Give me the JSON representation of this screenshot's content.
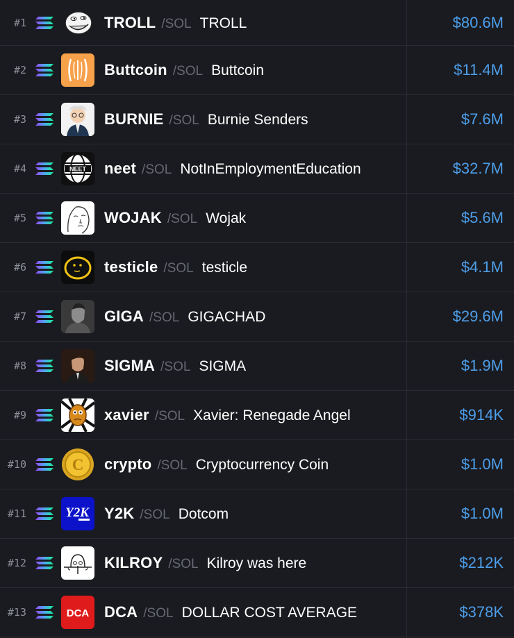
{
  "colors": {
    "background": "#1a1b20",
    "row_border": "#2b2c33",
    "rank": "#8e9099",
    "pair": "#666873",
    "market_cap": "#4d9ee9",
    "solana_gradient": [
      "#9945ff",
      "#4fa8f0",
      "#14f195"
    ]
  },
  "chain_icon": "solana-icon",
  "tokens": [
    {
      "rank": "#1",
      "ticker": "TROLL",
      "pair": "/SOL",
      "name": "TROLL",
      "market_cap": "$80.6M",
      "icon": "troll-face-icon"
    },
    {
      "rank": "#2",
      "ticker": "Buttcoin",
      "pair": "/SOL",
      "name": "Buttcoin",
      "market_cap": "$11.4M",
      "icon": "buttcoin-logo-icon"
    },
    {
      "rank": "#3",
      "ticker": "BURNIE",
      "pair": "/SOL",
      "name": "Burnie Senders",
      "market_cap": "$7.6M",
      "icon": "burnie-portrait-icon"
    },
    {
      "rank": "#4",
      "ticker": "neet",
      "pair": "/SOL",
      "name": "NotInEmploymentEducation",
      "market_cap": "$32.7M",
      "icon": "neet-globe-icon"
    },
    {
      "rank": "#5",
      "ticker": "WOJAK",
      "pair": "/SOL",
      "name": "Wojak",
      "market_cap": "$5.6M",
      "icon": "wojak-face-icon"
    },
    {
      "rank": "#6",
      "ticker": "testicle",
      "pair": "/SOL",
      "name": "testicle",
      "market_cap": "$4.1M",
      "icon": "testicle-face-icon"
    },
    {
      "rank": "#7",
      "ticker": "GIGA",
      "pair": "/SOL",
      "name": "GIGACHAD",
      "market_cap": "$29.6M",
      "icon": "gigachad-portrait-icon"
    },
    {
      "rank": "#8",
      "ticker": "SIGMA",
      "pair": "/SOL",
      "name": "SIGMA",
      "market_cap": "$1.9M",
      "icon": "sigma-portrait-icon"
    },
    {
      "rank": "#9",
      "ticker": "xavier",
      "pair": "/SOL",
      "name": "Xavier: Renegade Angel",
      "market_cap": "$914K",
      "icon": "xavier-face-icon"
    },
    {
      "rank": "#10",
      "ticker": "crypto",
      "pair": "/SOL",
      "name": "Cryptocurrency Coin",
      "market_cap": "$1.0M",
      "icon": "gold-coin-icon"
    },
    {
      "rank": "#11",
      "ticker": "Y2K",
      "pair": "/SOL",
      "name": "Dotcom",
      "market_cap": "$1.0M",
      "icon": "y2k-logo-icon"
    },
    {
      "rank": "#12",
      "ticker": "KILROY",
      "pair": "/SOL",
      "name": "Kilroy was here",
      "market_cap": "$212K",
      "icon": "kilroy-drawing-icon"
    },
    {
      "rank": "#13",
      "ticker": "DCA",
      "pair": "/SOL",
      "name": "DOLLAR COST AVERAGE",
      "market_cap": "$378K",
      "icon": "dca-logo-icon"
    }
  ]
}
